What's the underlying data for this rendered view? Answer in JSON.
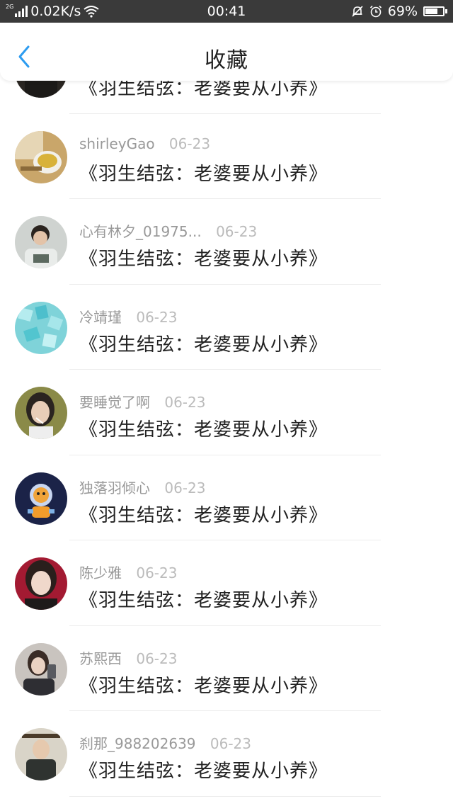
{
  "status_bar": {
    "network_type": "2G",
    "speed": "0.02K/s",
    "time": "00:41",
    "battery": "69%",
    "battery_level": 0.69
  },
  "header": {
    "title": "收藏",
    "back_icon": "chevron-left-icon"
  },
  "items": [
    {
      "user": "",
      "date": "",
      "title": "《羽生结弦：老婆要从小养》"
    },
    {
      "user": "shirleyGao",
      "date": "06-23",
      "title": "《羽生结弦：老婆要从小养》"
    },
    {
      "user": "心有林夕_01975...",
      "date": "06-23",
      "title": "《羽生结弦：老婆要从小养》"
    },
    {
      "user": "冷靖瑾",
      "date": "06-23",
      "title": "《羽生结弦：老婆要从小养》"
    },
    {
      "user": "要睡觉了啊",
      "date": "06-23",
      "title": "《羽生结弦：老婆要从小养》"
    },
    {
      "user": "独落羽倾心",
      "date": "06-23",
      "title": "《羽生结弦：老婆要从小养》"
    },
    {
      "user": "陈少雅",
      "date": "06-23",
      "title": "《羽生结弦：老婆要从小养》"
    },
    {
      "user": "苏熙西",
      "date": "06-23",
      "title": "《羽生结弦：老婆要从小养》"
    },
    {
      "user": "刹那_988202639",
      "date": "06-23",
      "title": "《羽生结弦：老婆要从小养》"
    }
  ],
  "colors": {
    "accent": "#2d9cf0",
    "status_bar_bg": "#3a3a3a",
    "meta_text": "#999999"
  }
}
